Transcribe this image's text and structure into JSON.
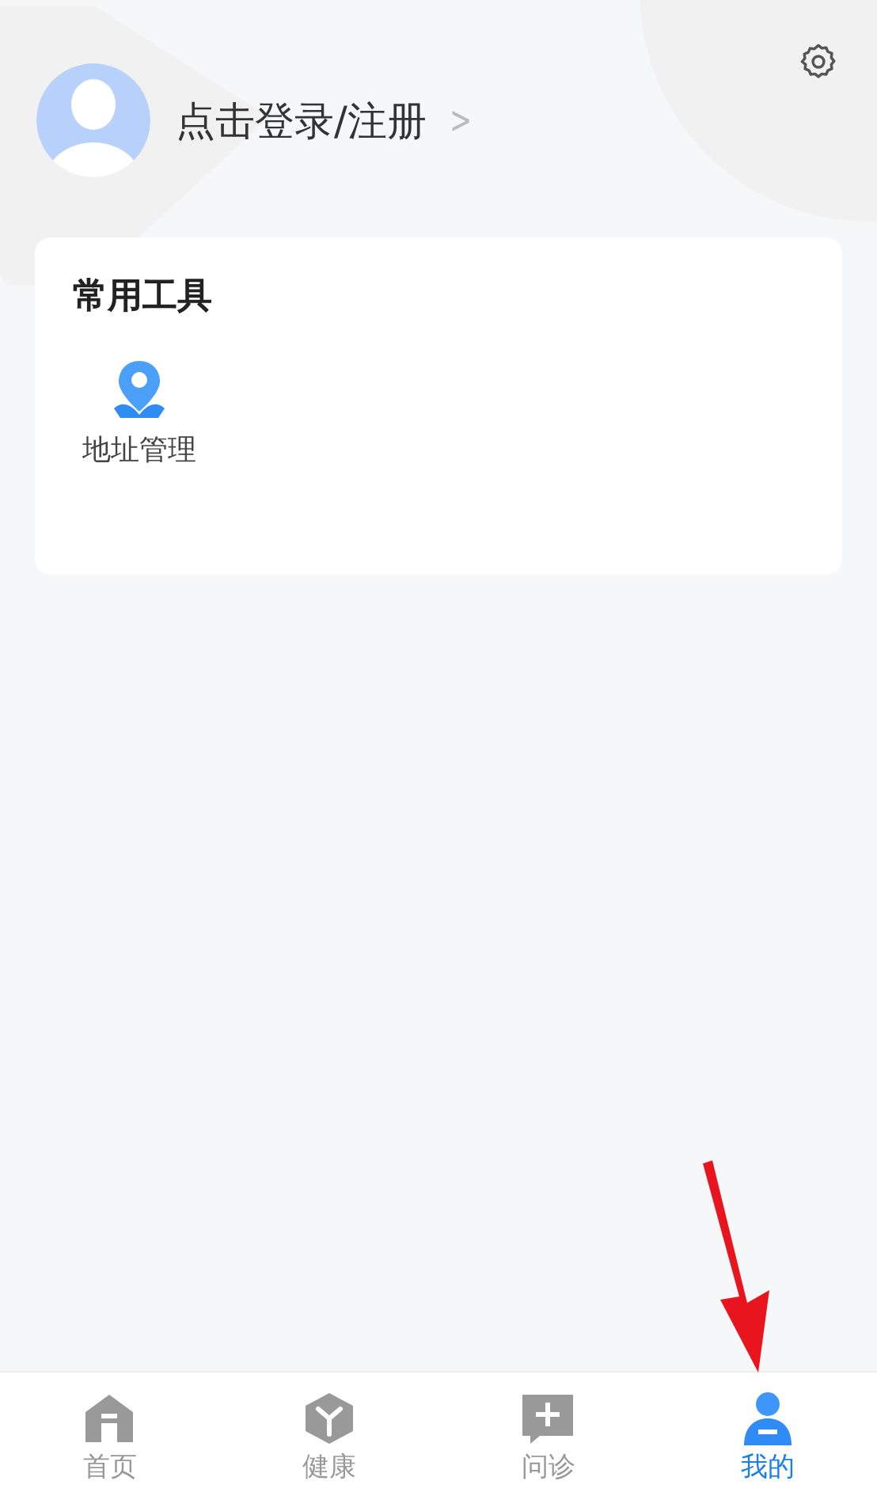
{
  "profile": {
    "login_text": "点击登录/注册",
    "chevron": ">"
  },
  "tools_card": {
    "title": "常用工具",
    "items": [
      {
        "kind": "address",
        "label": "地址管理"
      }
    ]
  },
  "tab_bar": [
    {
      "kind": "home",
      "label": "首页",
      "selected": false
    },
    {
      "kind": "health",
      "label": "健康",
      "selected": false
    },
    {
      "kind": "consult",
      "label": "问诊",
      "selected": false
    },
    {
      "kind": "mine",
      "label": "我的",
      "selected": true
    }
  ]
}
